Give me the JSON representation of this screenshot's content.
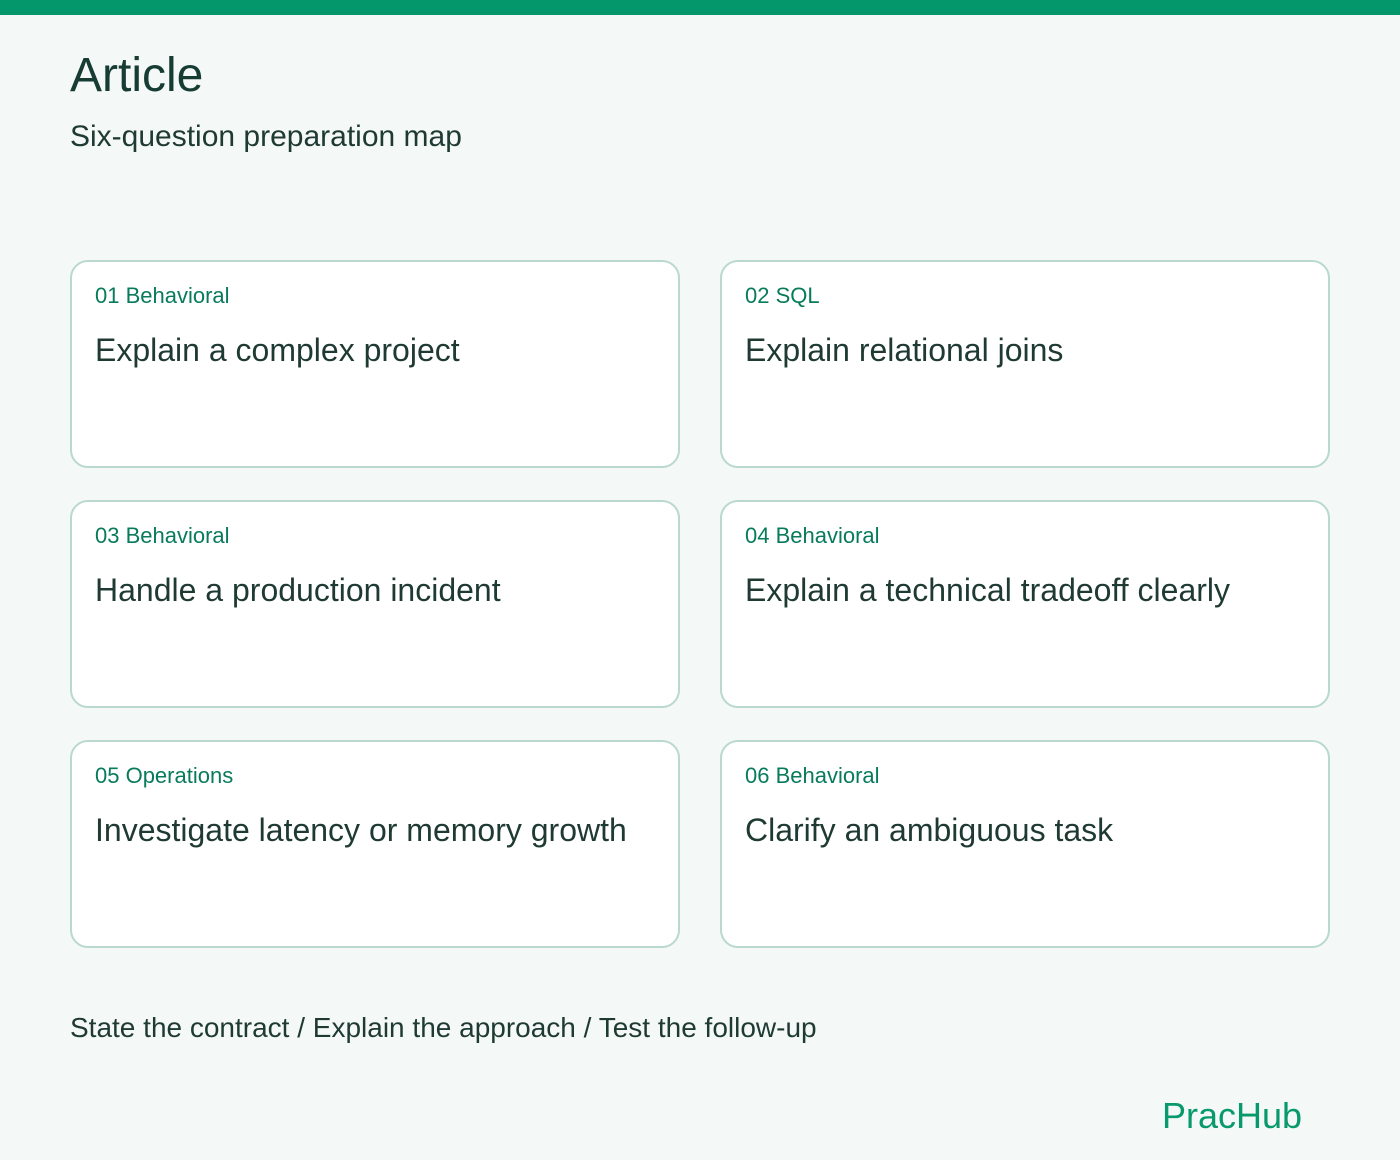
{
  "header": {
    "title": "Article",
    "subtitle": "Six-question preparation map"
  },
  "cards": [
    {
      "tag": "01 Behavioral",
      "title": "Explain a complex project"
    },
    {
      "tag": "02 SQL",
      "title": "Explain relational joins"
    },
    {
      "tag": "03 Behavioral",
      "title": "Handle a production incident"
    },
    {
      "tag": "04 Behavioral",
      "title": "Explain a technical tradeoff clearly"
    },
    {
      "tag": "05 Operations",
      "title": "Investigate latency or memory growth"
    },
    {
      "tag": "06 Behavioral",
      "title": "Clarify an ambiguous task"
    }
  ],
  "footer": {
    "note": "State the contract / Explain the approach / Test the follow-up",
    "brand": "PracHub"
  },
  "colors": {
    "accent": "#04976b",
    "background": "#f4f8f6",
    "card_border": "#b9d9cd",
    "tag_text": "#087b5b",
    "body_text": "#1f3a33"
  }
}
